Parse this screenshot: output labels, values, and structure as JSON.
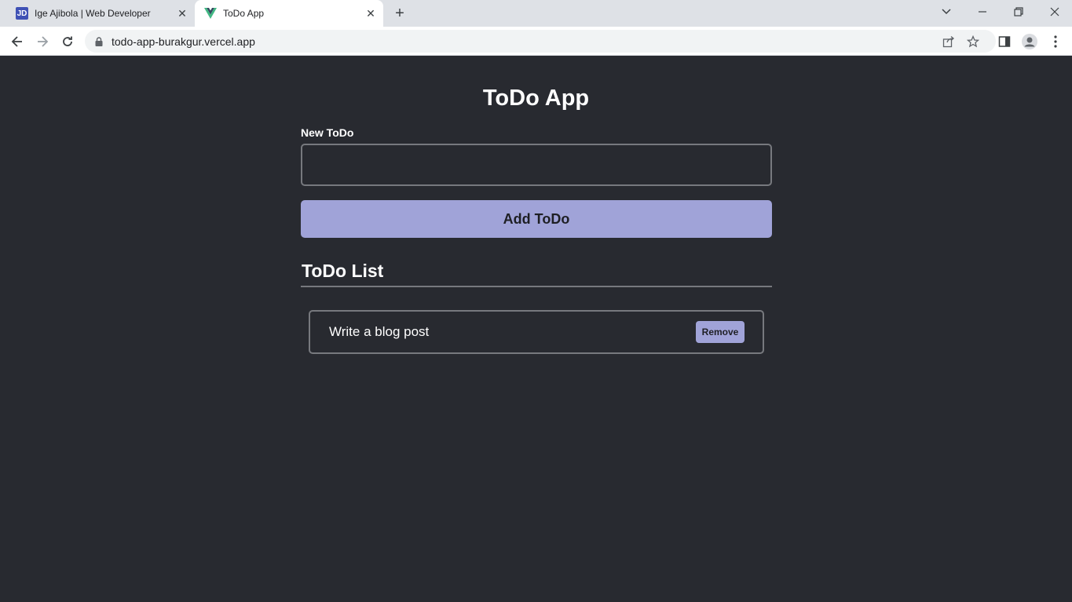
{
  "browser": {
    "tabs": [
      {
        "title": "Ige Ajibola | Web Developer",
        "favicon": "JD",
        "active": false
      },
      {
        "title": "ToDo App",
        "favicon": "vue-logo-icon",
        "active": true
      }
    ],
    "url": "todo-app-burakgur.vercel.app"
  },
  "app": {
    "title": "ToDo App",
    "new_label": "New ToDo",
    "input_value": "",
    "add_button": "Add ToDo",
    "list_heading": "ToDo List",
    "todos": [
      {
        "text": "Write a blog post",
        "remove_label": "Remove"
      }
    ]
  },
  "colors": {
    "background": "#282a30",
    "accent": "#a0a3d8",
    "border": "#77797e"
  }
}
